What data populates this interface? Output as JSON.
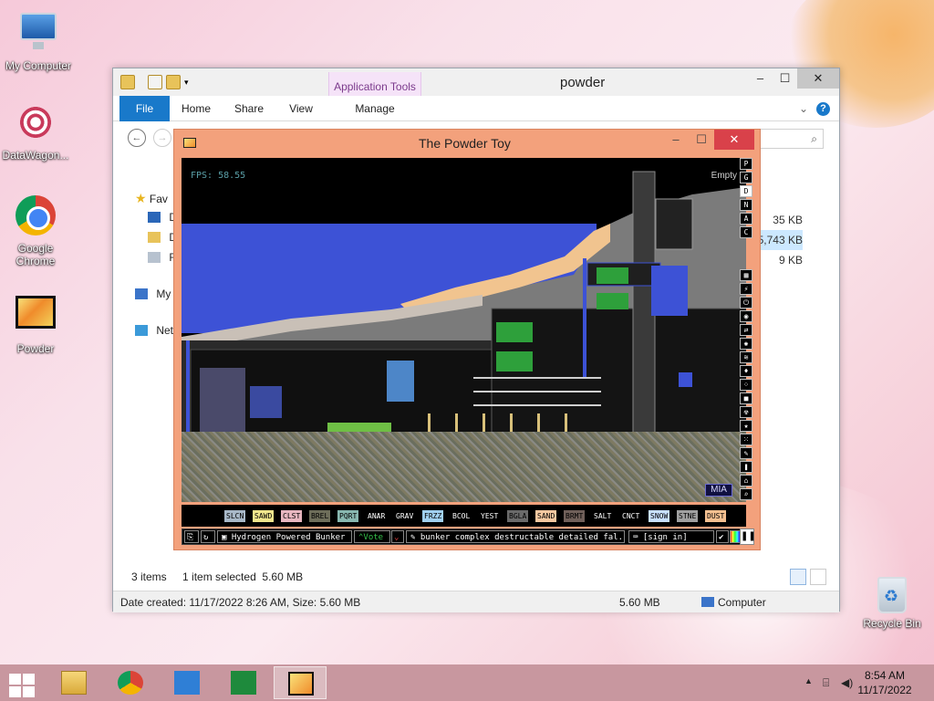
{
  "desktop": {
    "icons": [
      {
        "label": "My Computer"
      },
      {
        "label": "DataWagon..."
      },
      {
        "label": "Google Chrome"
      },
      {
        "label": "Powder"
      }
    ],
    "recycle_bin": "Recycle Bin"
  },
  "explorer": {
    "title": "powder",
    "contextual_tab": "Application Tools",
    "tabs": [
      "File",
      "Home",
      "Share",
      "View",
      "Manage"
    ],
    "nav_items": [
      "Fav",
      "D",
      "D",
      "R",
      "My",
      "Net"
    ],
    "file_sizes": [
      "35 KB",
      "5,743 KB",
      "9 KB"
    ],
    "status_items": "3 items",
    "status_selected": "1 item selected  5.60 MB",
    "details_created": "Date created: 11/17/2022 8:26 AM, Size: 5.60 MB",
    "details_size": "5.60 MB",
    "details_location": "Computer"
  },
  "powder_toy": {
    "title": "The Powder Toy",
    "fps": "FPS: 58.55",
    "hover_label": "Empty",
    "mode_buttons": [
      "P",
      "G",
      "D",
      "N",
      "A",
      "C"
    ],
    "elements": [
      {
        "name": "SLCN",
        "bg": "#a8b8c8",
        "fg": "#000000"
      },
      {
        "name": "SAWD",
        "bg": "#f0e68c",
        "fg": "#000000"
      },
      {
        "name": "CLST",
        "bg": "#e8b7c0",
        "fg": "#000000"
      },
      {
        "name": "BREL",
        "bg": "#6e6e5a",
        "fg": "#000000"
      },
      {
        "name": "PQRT",
        "bg": "#88b8b0",
        "fg": "#000000"
      },
      {
        "name": "ANAR",
        "bg": "#000000",
        "fg": "#ffffff"
      },
      {
        "name": "GRAV",
        "bg": "#000000",
        "fg": "#ffffff"
      },
      {
        "name": "FRZZ",
        "bg": "#a0d0f0",
        "fg": "#000000"
      },
      {
        "name": "BCOL",
        "bg": "#000000",
        "fg": "#ffffff"
      },
      {
        "name": "YEST",
        "bg": "#000000",
        "fg": "#ffffff"
      },
      {
        "name": "BGLA",
        "bg": "#6a6a6a",
        "fg": "#000000"
      },
      {
        "name": "SAND",
        "bg": "#f5c8a0",
        "fg": "#000000"
      },
      {
        "name": "BRMT",
        "bg": "#70605a",
        "fg": "#000000"
      },
      {
        "name": "SALT",
        "bg": "#000000",
        "fg": "#ffffff"
      },
      {
        "name": "CNCT",
        "bg": "#000000",
        "fg": "#ffffff"
      },
      {
        "name": "SNOW",
        "bg": "#c8e0ff",
        "fg": "#000000"
      },
      {
        "name": "STNE",
        "bg": "#a0a0a0",
        "fg": "#000000"
      },
      {
        "name": "DUST",
        "bg": "#f5c090",
        "fg": "#000000"
      }
    ],
    "save_name": "Hydrogen Powered Bunker",
    "vote_label": "Vote",
    "tags": "bunker complex destructable detailed fal...",
    "sign_in": "[sign in]",
    "mia_label": "MIA"
  },
  "taskbar": {
    "time": "8:54 AM",
    "date": "11/17/2022"
  }
}
